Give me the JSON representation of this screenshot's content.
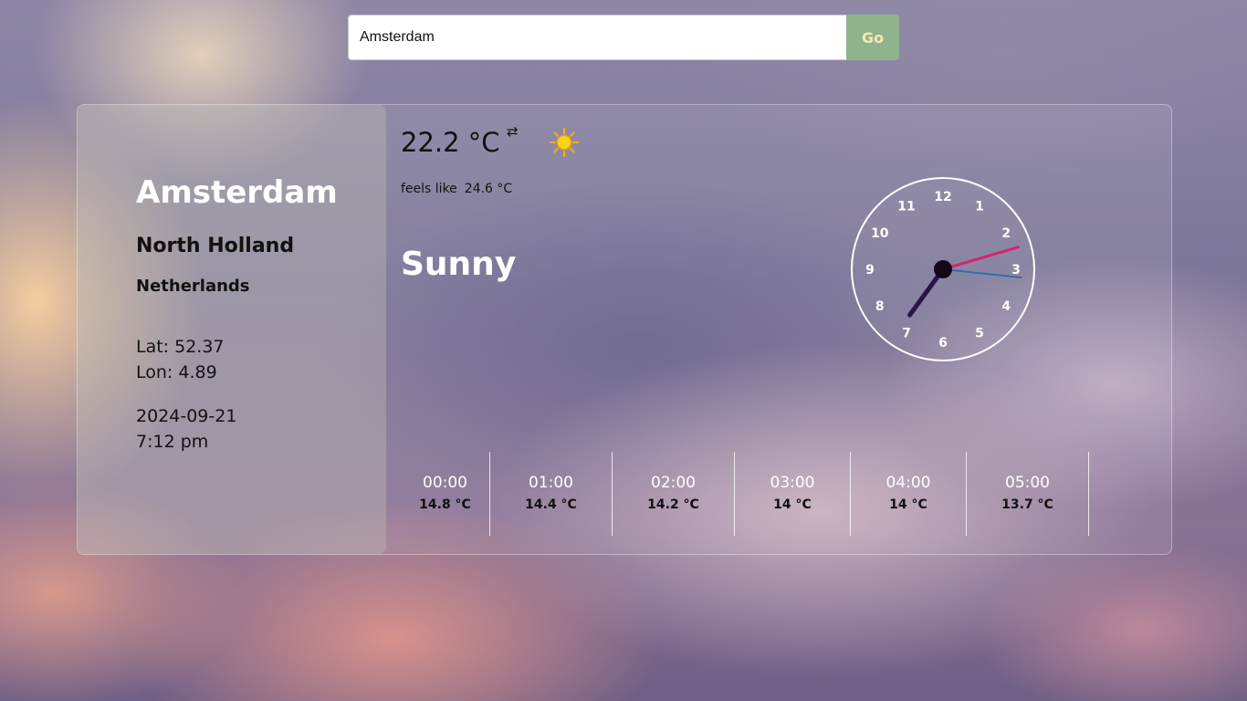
{
  "search": {
    "value": "Amsterdam",
    "button_label": "Go"
  },
  "location": {
    "city": "Amsterdam",
    "region": "North Holland",
    "country": "Netherlands",
    "lat": "Lat: 52.37",
    "lon": "Lon: 4.89",
    "date": "2024-09-21",
    "time": "7:12 pm"
  },
  "current": {
    "temp": "22.2 °C",
    "swap_glyph": "⇄",
    "icon": "sun-icon",
    "feels_label": "feels like",
    "feels_value": "24.6 °C",
    "condition": "Sunny"
  },
  "clock": {
    "numbers": [
      "12",
      "1",
      "2",
      "3",
      "4",
      "5",
      "6",
      "7",
      "8",
      "9",
      "10",
      "11"
    ],
    "time": {
      "hour": 7,
      "minute": 12,
      "second": 16
    },
    "colors": {
      "hour": "#2b1247",
      "minute": "#d0276f",
      "second": "#2f6fb0",
      "face": "#ffffff"
    }
  },
  "hourly": [
    {
      "time": "00:00",
      "temp": "14.8 °C"
    },
    {
      "time": "01:00",
      "temp": "14.4 °C"
    },
    {
      "time": "02:00",
      "temp": "14.2 °C"
    },
    {
      "time": "03:00",
      "temp": "14 °C"
    },
    {
      "time": "04:00",
      "temp": "14 °C"
    },
    {
      "time": "05:00",
      "temp": "13.7 °C"
    }
  ]
}
